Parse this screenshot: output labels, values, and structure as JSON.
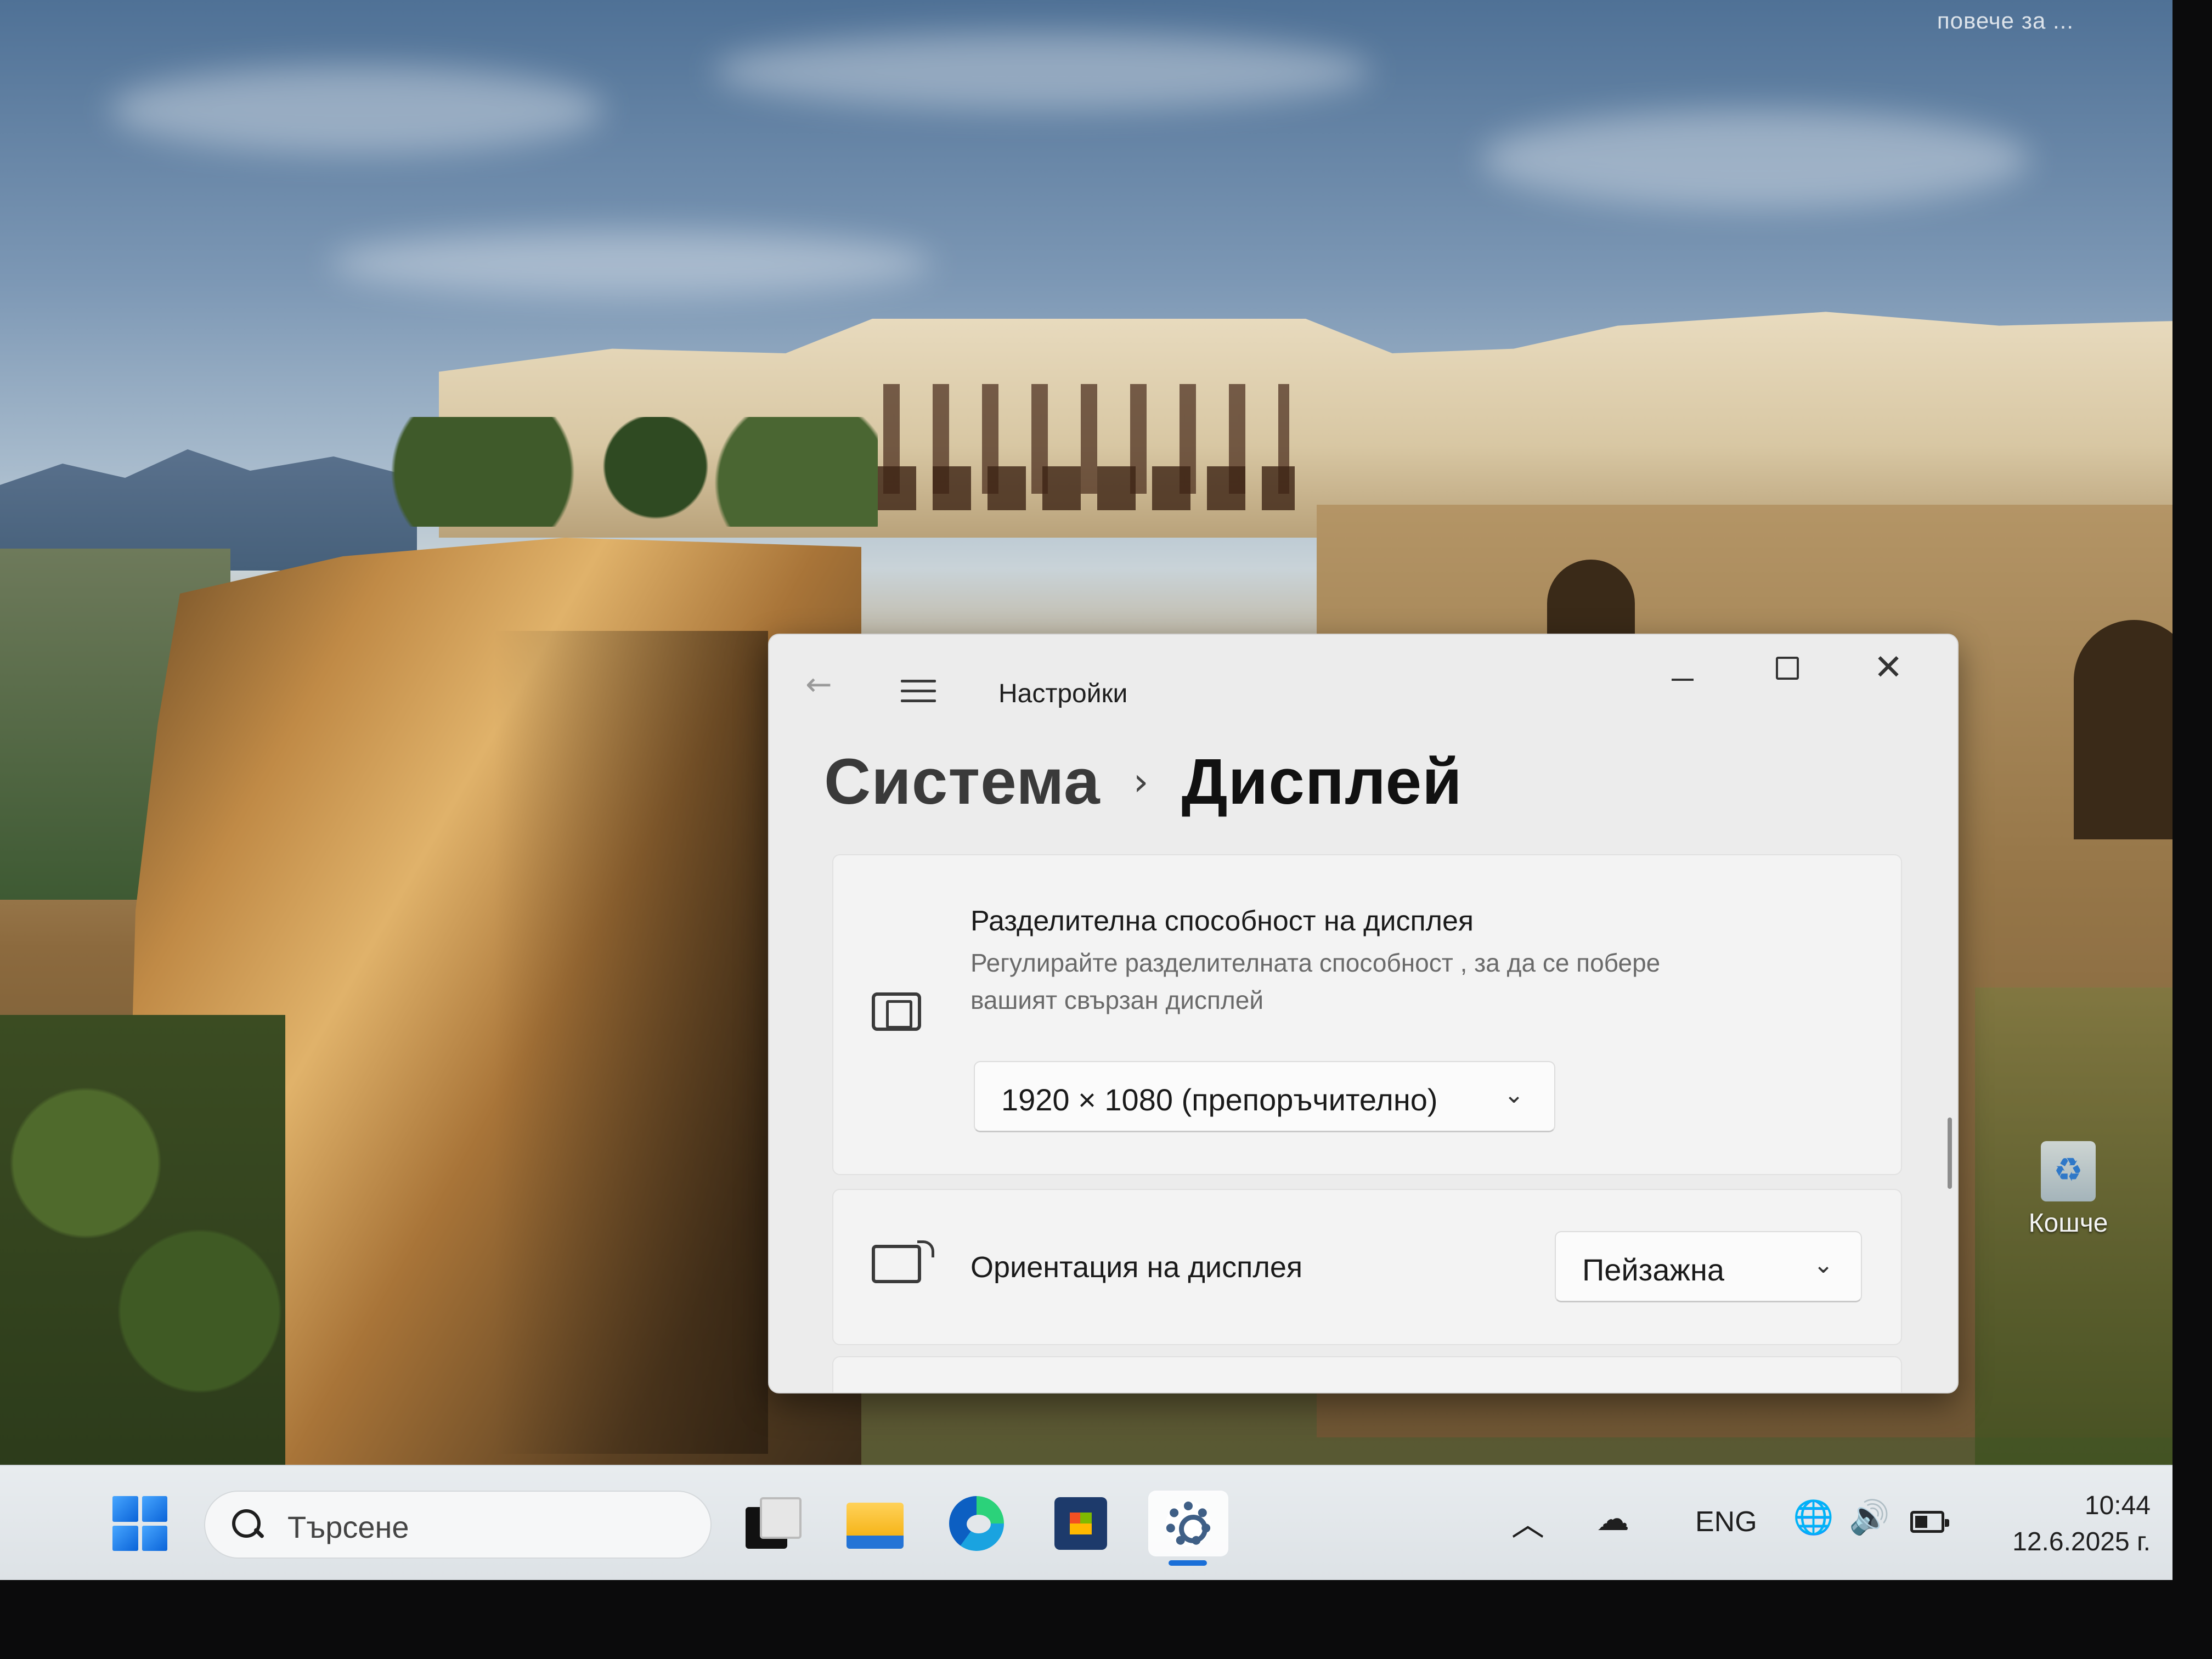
{
  "desktop": {
    "corner_text": "повече за ...",
    "recycle_bin_label": "Кошче"
  },
  "window": {
    "title": "Настройки",
    "breadcrumb": {
      "parent": "Система",
      "separator": "›",
      "current": "Дисплей"
    },
    "resolution": {
      "title": "Разделителна способност на дисплея",
      "description": "Регулирайте разделителната способност , за да се побере вашият свързан дисплей",
      "selected": "1920 × 1080 (препоръчително)"
    },
    "orientation": {
      "label": "Ориентация на дисплея",
      "selected": "Пейзажна"
    }
  },
  "taskbar": {
    "search_placeholder": "Търсене",
    "language": "ENG",
    "time": "10:44",
    "date": "12.6.2025 г.",
    "accent_color": "#1a6fd8"
  }
}
